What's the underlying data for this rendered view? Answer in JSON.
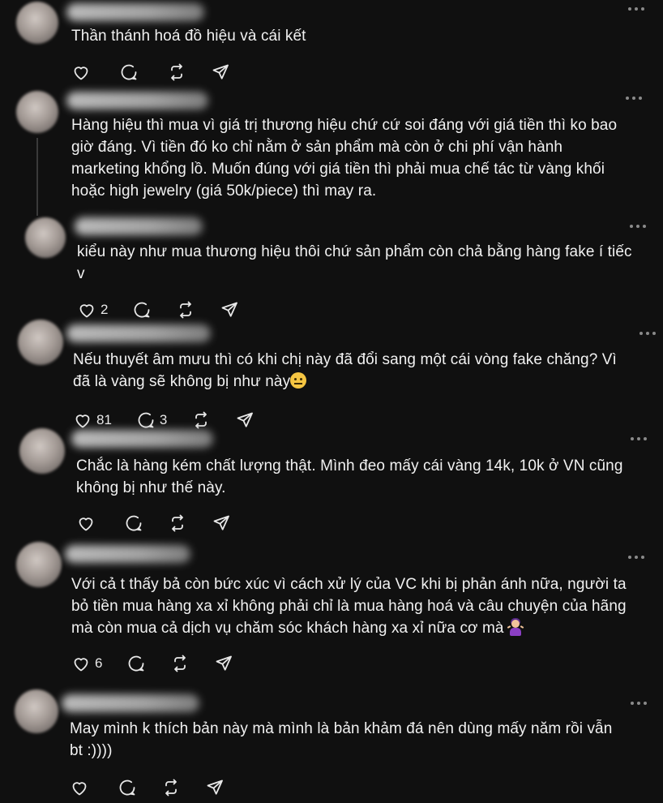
{
  "posts": [
    {
      "text": "Thần thánh hoá đồ hiệu và cái kết",
      "likes": "",
      "replies": ""
    },
    {
      "text": "Hàng hiệu thì mua vì giá trị thương hiệu chứ cứ soi đáng với giá tiền thì ko bao\ngiờ đáng. Vì tiền đó ko chỉ nằm ở sản phẩm mà còn ở chi phí vận hành\nmarketing khổng lồ. Muốn đúng với giá tiền thì phải mua chế tác từ vàng khối\nhoặc high jewelry (giá 50k/piece) thì may ra.",
      "likes": "",
      "replies": ""
    },
    {
      "text": "kiểu này như mua thương hiệu thôi chứ sản phẩm còn chả bằng hàng fake í tiếc\nv",
      "likes": "2",
      "replies": ""
    },
    {
      "text": "Nếu thuyết âm mưu thì có khi chị này đã đổi sang một cái vòng fake chăng? Vì\nđã là vàng sẽ không bị như này",
      "likes": "81",
      "replies": "3"
    },
    {
      "text": "Chắc là hàng kém chất lượng thật. Mình đeo mấy cái vàng 14k, 10k ở VN cũng\nkhông bị như thế này.",
      "likes": "",
      "replies": ""
    },
    {
      "text": "Với cả t thấy bả còn bức xúc vì cách xử lý của VC khi bị phản ánh nữa, người ta\nbỏ tiền mua hàng xa xỉ không phải chỉ là mua hàng hoá và câu chuyện của hãng\nmà còn mua cả dịch vụ chăm sóc khách hàng xa xỉ nữa cơ mà",
      "likes": "6",
      "replies": ""
    },
    {
      "text": "May mình k thích bản này mà mình là bản khảm đá nên dùng mấy năm rồi vẫn\nbt :))))",
      "likes": "",
      "replies": ""
    }
  ],
  "icons": {
    "like": "heart-icon",
    "reply": "speech-bubble-icon",
    "repost": "repost-icon",
    "share": "send-icon",
    "more": "more-dots-icon"
  },
  "colors": {
    "background": "#101010",
    "text": "#f3f3f3",
    "muted": "#8a8a8a"
  }
}
